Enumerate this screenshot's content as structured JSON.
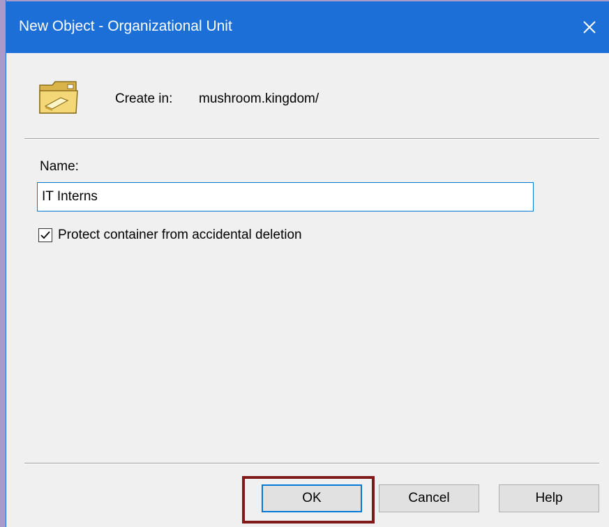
{
  "window": {
    "title": "New Object - Organizational Unit"
  },
  "header": {
    "create_in_label": "Create in:",
    "create_in_value": "mushroom.kingdom/"
  },
  "form": {
    "name_label": "Name:",
    "name_value": "IT Interns",
    "protect_label": "Protect container from accidental deletion",
    "protect_checked": true
  },
  "buttons": {
    "ok_label": "OK",
    "cancel_label": "Cancel",
    "help_label": "Help"
  },
  "icons": {
    "folder": "organizational-unit-folder-icon",
    "close": "close-icon",
    "checkmark": "checkmark-icon"
  },
  "colors": {
    "titlebar": "#1c6fd6",
    "focus_border": "#0078d7",
    "highlight": "#7e1a1a",
    "background": "#f0f0f0"
  }
}
